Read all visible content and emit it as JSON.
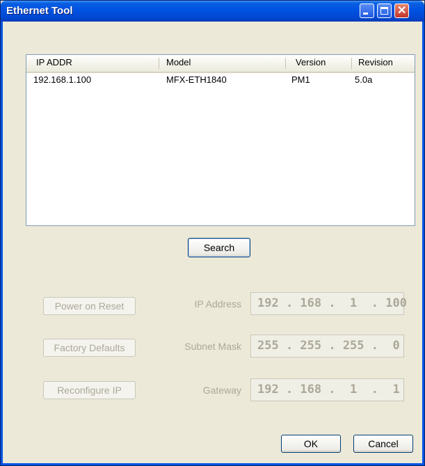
{
  "window": {
    "title": "Ethernet Tool"
  },
  "list": {
    "columns": [
      "IP ADDR",
      "Model",
      "Version",
      "Revision"
    ],
    "rows": [
      [
        "192.168.1.100",
        "MFX-ETH1840",
        "PM1",
        "5.0a"
      ]
    ]
  },
  "buttons": {
    "search": "Search",
    "power_on_reset": "Power on Reset",
    "factory_defaults": "Factory Defaults",
    "reconfigure_ip": "Reconfigure IP",
    "ok": "OK",
    "cancel": "Cancel"
  },
  "fields": {
    "ip_label": "IP Address",
    "ip_value": "192 . 168 .  1  . 100",
    "mask_label": "Subnet Mask",
    "mask_value": "255 . 255 . 255 .  0",
    "gw_label": "Gateway",
    "gw_value": "192 . 168 .  1  .  1"
  }
}
